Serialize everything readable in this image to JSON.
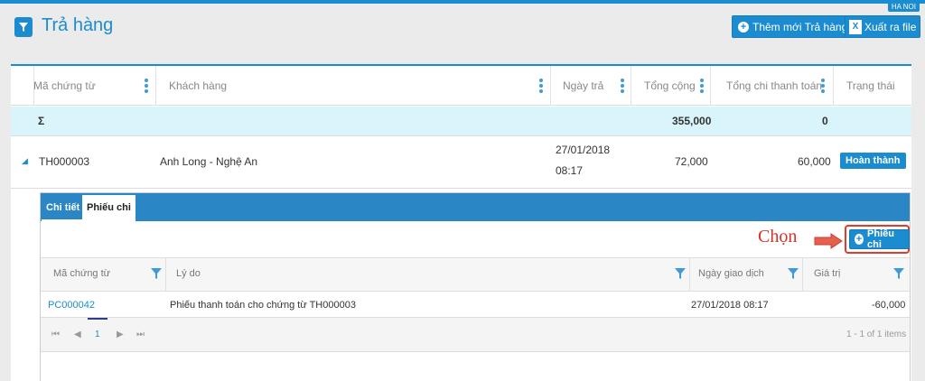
{
  "header": {
    "title": "Trả hàng",
    "location": "HA NOI",
    "add_button": "Thêm mới Trả hàng",
    "export_button": "Xuất ra file"
  },
  "table": {
    "columns": [
      "Mã chứng từ",
      "Khách hàng",
      "Ngày trả",
      "Tổng cộng",
      "Tổng chi thanh toán",
      "Trạng thái"
    ],
    "summary": {
      "label": "Σ",
      "total": "355,000",
      "paid": "0"
    },
    "rows": [
      {
        "code": "TH000003",
        "customer": "Anh Long - Nghệ An",
        "date": "27/01/2018",
        "time": "08:17",
        "total": "72,000",
        "paid": "60,000",
        "status": "Hoàn thành"
      }
    ]
  },
  "detail": {
    "tabs": [
      "Chi tiết",
      "Phiếu chi"
    ],
    "annotation": "Chọn",
    "add_voucher_button": "Phiếu chi",
    "columns": [
      "Mã chứng từ",
      "Lý do",
      "Ngày giao dịch",
      "Giá trị"
    ],
    "rows": [
      {
        "code": "PC000042",
        "reason": "Phiếu thanh toán cho chứng từ TH000003",
        "date": "27/01/2018 08:17",
        "value": "-60,000"
      }
    ],
    "pager": {
      "page": "1",
      "info": "1 - 1 of 1 items"
    }
  },
  "colors": {
    "accent": "#1a8ccf",
    "annotation": "#d8322b",
    "summary_bg": "#d9f4fb"
  }
}
